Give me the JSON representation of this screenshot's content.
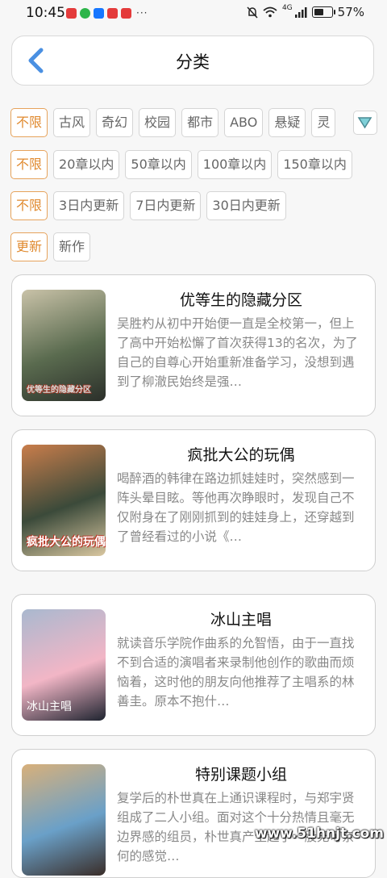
{
  "status_bar": {
    "time": "10:45",
    "notification_icons": [
      "app-red-icon",
      "wechat-icon",
      "alipay-icon",
      "app-red-icon",
      "app-red-icon"
    ],
    "more": "···",
    "battery_percent": "57%",
    "battery_level": 0.57,
    "network": "4G"
  },
  "header": {
    "title": "分类"
  },
  "filters": {
    "genre": [
      "不限",
      "古风",
      "奇幻",
      "校园",
      "都市",
      "ABO",
      "悬疑",
      "灵"
    ],
    "length": [
      "不限",
      "20章以内",
      "50章以内",
      "100章以内",
      "150章以内"
    ],
    "update": [
      "不限",
      "3日内更新",
      "7日内更新",
      "30日内更新"
    ],
    "sort": [
      "更新",
      "新作"
    ]
  },
  "books": [
    {
      "title": "优等生的隐藏分区",
      "description": "吴胜杓从初中开始便一直是全校第一，但上了高中开始松懈了首次获得13的名次，为了自己的自尊心开始重新准备学习，没想到遇到了柳澈民始终是强…",
      "cover_text": "优等生的隐藏分区",
      "cover_colors": [
        "#c9c2a8",
        "#5a6b4f",
        "#2b2f2a"
      ]
    },
    {
      "title": "疯批大公的玩偶",
      "description": "喝醉酒的韩律在路边抓娃娃时，突然感到一阵头晕目眩。等他再次睁眼时，发现自己不仅附身在了刚刚抓到的娃娃身上，还穿越到了曾经看过的小说《…",
      "cover_text": "疯批大公的玩偶",
      "cover_colors": [
        "#c97d4b",
        "#3b4a3a",
        "#d9c7a0"
      ]
    },
    {
      "title": "冰山主唱",
      "description": "就读音乐学院作曲系的允智悟，由于一直找不到合适的演唱者来录制他创作的歌曲而烦恼着，这时他的朋友向他推荐了主唱系的林善圭。原本不抱什…",
      "cover_text": "冰山主唱",
      "cover_colors": [
        "#a9b8cf",
        "#f2b6c6",
        "#1f2430"
      ]
    },
    {
      "title": "特别课题小组",
      "description": "复学后的朴世真在上通识课程时，与郑宇贤组成了二人小组。面对这个十分热情且毫无边界感的组员，朴世真产生起了一股无可奈何的感觉…",
      "cover_text": "",
      "cover_colors": [
        "#d8b07a",
        "#6aa0c8",
        "#3a2d28"
      ]
    }
  ],
  "watermark": "www.51hnjt.com"
}
